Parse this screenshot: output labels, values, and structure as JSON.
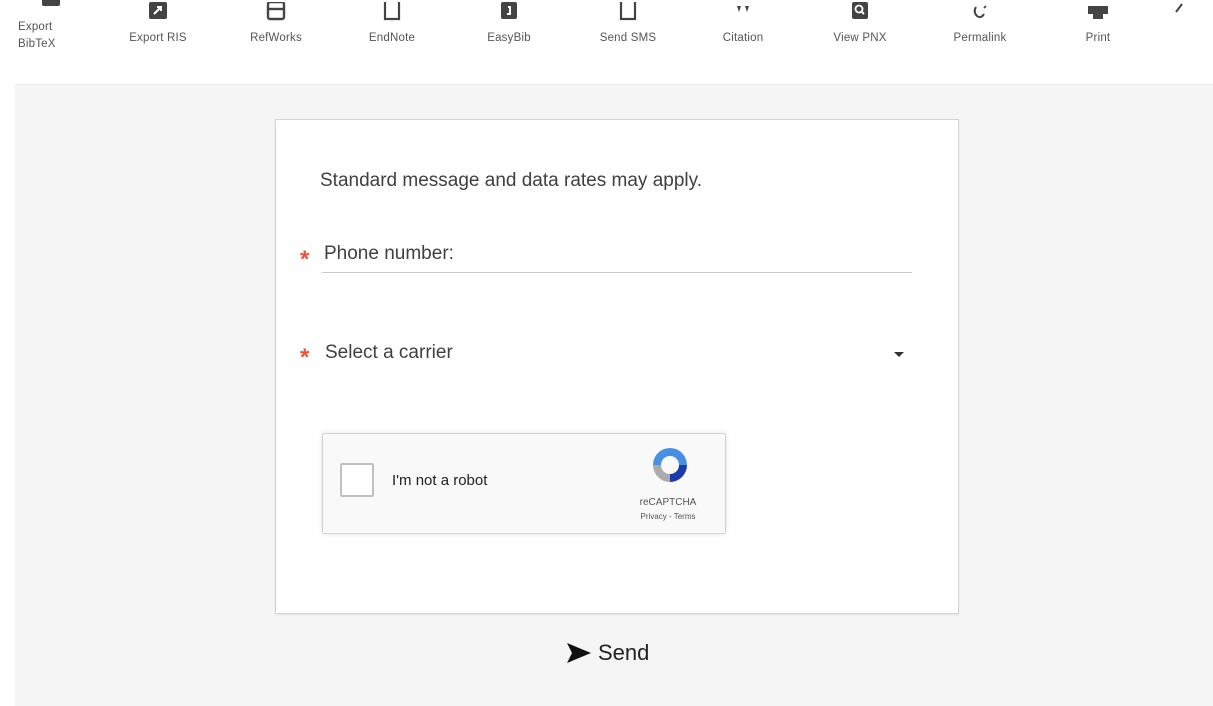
{
  "toolbar": {
    "items": [
      {
        "label": "Export BibTeX",
        "icon": "export-bibtex-icon"
      },
      {
        "label": "Export RIS",
        "icon": "export-ris-icon"
      },
      {
        "label": "RefWorks",
        "icon": "refworks-icon"
      },
      {
        "label": "EndNote",
        "icon": "endnote-icon"
      },
      {
        "label": "EasyBib",
        "icon": "easybib-icon"
      },
      {
        "label": "Send SMS",
        "icon": "send-sms-icon"
      },
      {
        "label": "Citation",
        "icon": "citation-icon"
      },
      {
        "label": "View PNX",
        "icon": "view-pnx-icon"
      },
      {
        "label": "Permalink",
        "icon": "permalink-icon"
      },
      {
        "label": "Print",
        "icon": "print-icon"
      }
    ],
    "more_icon": "chevron-right-icon"
  },
  "sms_form": {
    "notice": "Standard message and data rates may apply.",
    "phone_placeholder": "Phone number:",
    "required_mark": "*",
    "carrier_label": "Select a carrier",
    "recaptcha": {
      "checkbox_label": "I'm not a robot",
      "brand": "reCAPTCHA",
      "links": "Privacy - Terms"
    },
    "send_label": "Send"
  },
  "colors": {
    "required": "#e8553e",
    "background": "#f5f5f5",
    "card": "#ffffff",
    "recaptcha_blue": "#4a90e2"
  }
}
